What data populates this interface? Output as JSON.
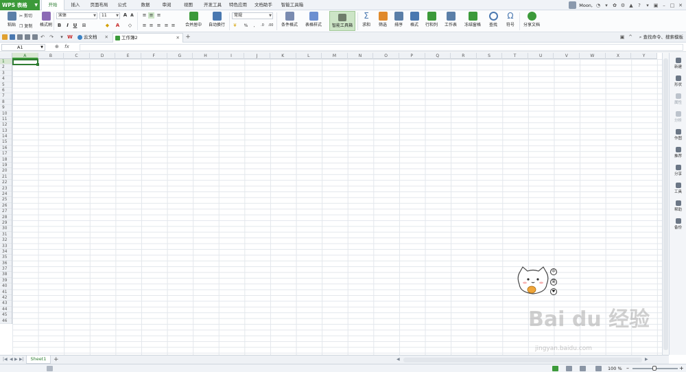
{
  "app": {
    "name": "WPS 表格"
  },
  "menu": [
    "开始",
    "插入",
    "页面布局",
    "公式",
    "数据",
    "审阅",
    "视图",
    "开发工具",
    "特色应用",
    "文档助手",
    "智能工具箱"
  ],
  "active_menu": "开始",
  "user": {
    "name": "Moon,"
  },
  "ribbon": {
    "paste": "粘贴",
    "cut": "剪切",
    "copy": "复制",
    "format_painter": "格式刷",
    "font": "宋体",
    "font_size": "11",
    "bold": "B",
    "italic": "I",
    "underline": "U",
    "merge_center": "合并居中",
    "wrap_text": "自动换行",
    "number_format": "常规",
    "percent": "%",
    "conditional_format": "条件格式",
    "table_style": "表格样式",
    "smart_toolbox": "智能工具箱",
    "sum": "求和",
    "filter": "筛选",
    "sort": "排序",
    "format": "格式",
    "row_col": "行和列",
    "worksheet": "工作表",
    "freeze": "冻结窗格",
    "find": "查找",
    "symbol": "符号",
    "share_doc": "分享文档"
  },
  "doc_tabs": [
    "云文档",
    "工作簿2"
  ],
  "search_commands": "查找命令、搜索模板",
  "formula_bar": {
    "name_box": "A1",
    "fx": "fx"
  },
  "columns": [
    "A",
    "B",
    "C",
    "D",
    "E",
    "F",
    "G",
    "H",
    "I",
    "J",
    "K",
    "L",
    "M",
    "N",
    "O",
    "P",
    "Q",
    "R",
    "S",
    "T",
    "U",
    "V",
    "W",
    "X",
    "Y"
  ],
  "row_count": 46,
  "right_panel": [
    "新建",
    "形状",
    "属性",
    "分析",
    "作图",
    "推荐",
    "分享",
    "工具",
    "帮助",
    "备份"
  ],
  "sticker_icons": [
    "中",
    "简"
  ],
  "sheet_tabs": [
    "Sheet1"
  ],
  "zoom": "100 %",
  "watermark": {
    "main": "Bai du 经验",
    "sub": "jingyan.baidu.com"
  },
  "colors": {
    "accent": "#3c9a3a",
    "grid": "#e3e7ec",
    "header_bg": "#eef1f5"
  }
}
